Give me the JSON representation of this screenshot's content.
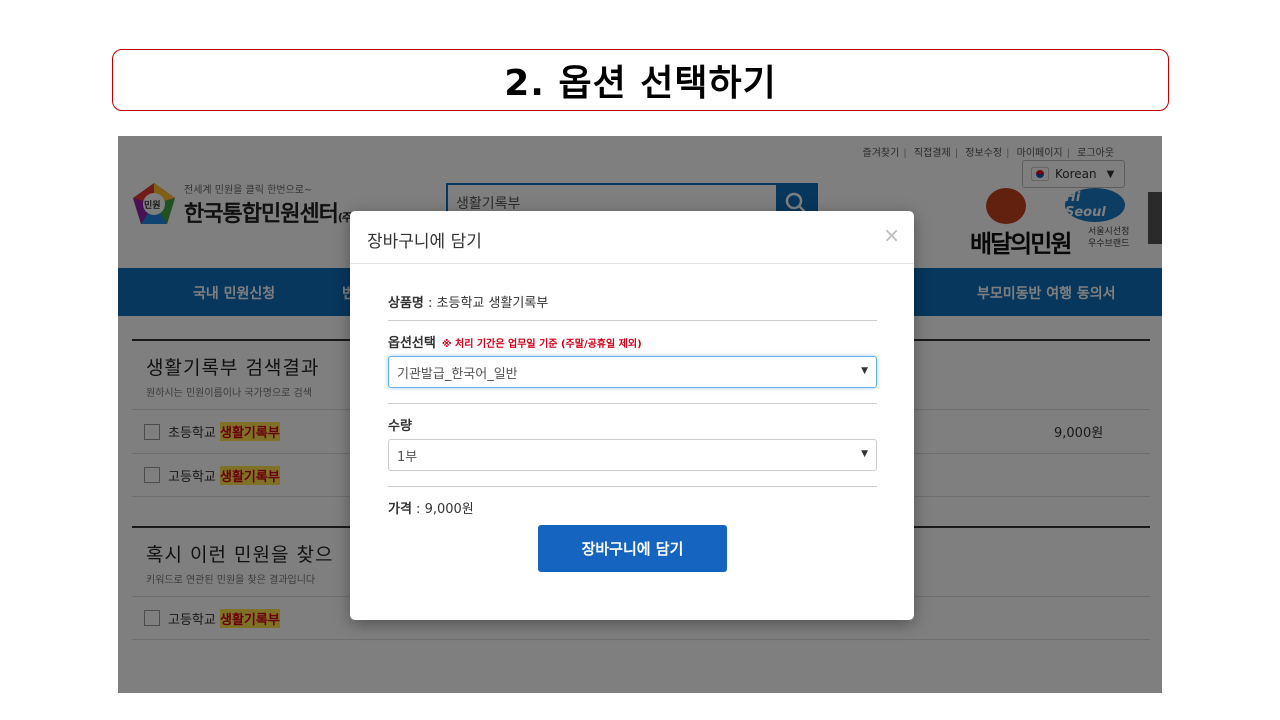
{
  "slide": {
    "title": "2. 옵션 선택하기"
  },
  "header": {
    "util_links": [
      "즐겨찾기",
      "직접결제",
      "정보수정",
      "마이페이지",
      "로그아웃"
    ],
    "language": "Korean",
    "logo_sub": "전세계 민원을 클릭 한번으로~",
    "logo_main": "한국통합민원센터",
    "logo_suffix": "(주)",
    "logo_badge": "민원",
    "search_value": "생활기록부",
    "brand_main": "배달의민원",
    "brand_hi": "Hi Seoul",
    "brand_sub1": "서울시선정",
    "brand_sub2": "우수브랜드"
  },
  "nav": {
    "items": [
      "국내 민원신청",
      "번",
      "부모미동반 여행 동의서"
    ]
  },
  "results": {
    "title": "생활기록부 검색결과",
    "desc": "원하시는 민원이름이나 국가명으로 검색",
    "rows": [
      {
        "prefix": "초등학교 ",
        "highlight": "생활기록부",
        "price": "9,000원"
      },
      {
        "prefix": "고등학교 ",
        "highlight": "생활기록부",
        "price": ""
      }
    ]
  },
  "suggest": {
    "title": "혹시 이런 민원을 찾으",
    "desc": "키워드로 연관된 민원을 찾은 결과입니다",
    "rows": [
      {
        "prefix": "고등학교 ",
        "highlight": "생활기록부"
      }
    ]
  },
  "modal": {
    "title": "장바구니에 담기",
    "close": "×",
    "product_label": "상품명",
    "product_value": " : 초등학교 생활기록부",
    "option_label": "옵션선택",
    "option_note": "※ 처리 기간은 업무일 기준 (주말/공휴일 제외)",
    "option_value": "기관발급_한국어_일반",
    "qty_label": "수량",
    "qty_value": "1부",
    "price_label": "가격",
    "price_value": " : 9,000원",
    "submit": "장바구니에 담기"
  },
  "colors": {
    "primary": "#0e6eb8",
    "button": "#1565c0",
    "accent_red": "#d0021b",
    "highlight": "#ffe34d"
  }
}
